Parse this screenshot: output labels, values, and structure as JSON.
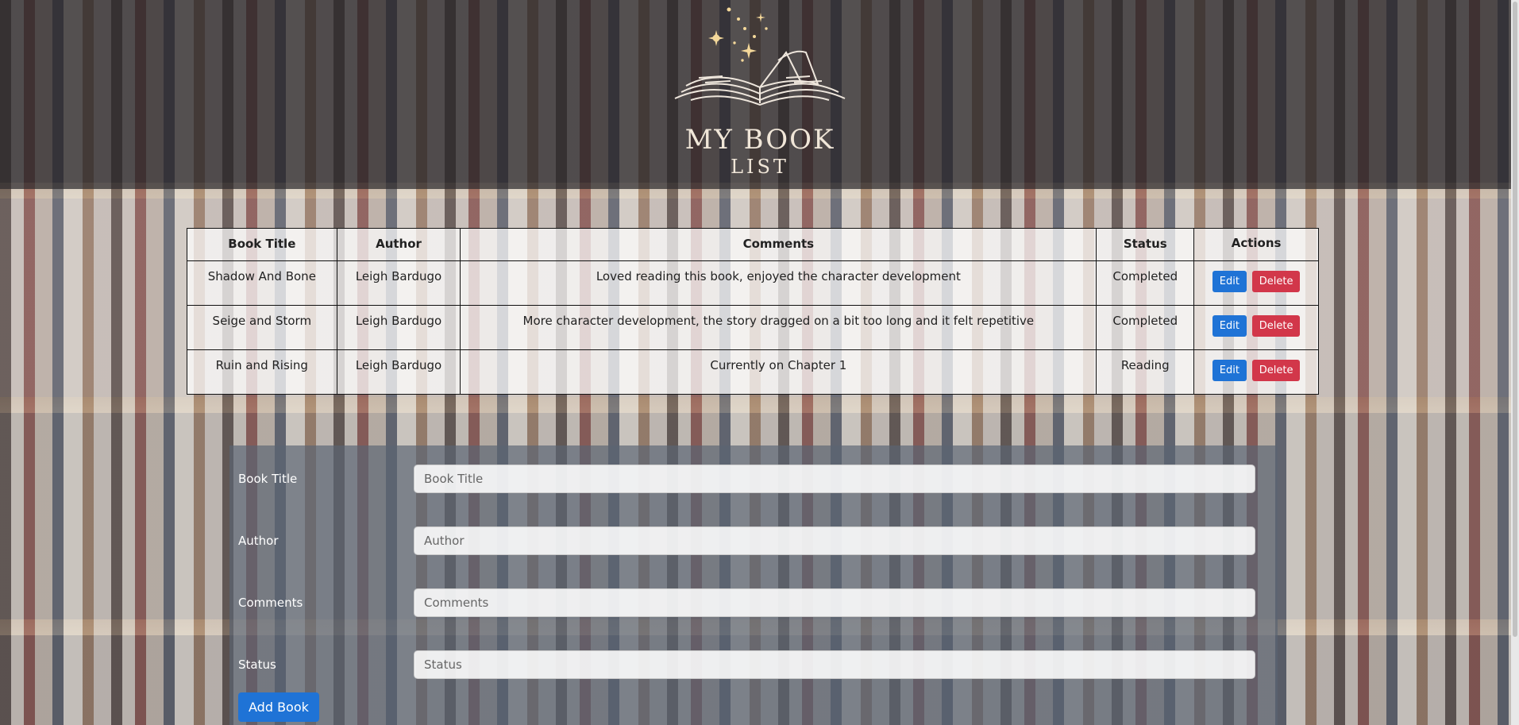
{
  "logo": {
    "line1": "MY BOOK",
    "line2": "LIST"
  },
  "table": {
    "headers": [
      "Book Title",
      "Author",
      "Comments",
      "Status",
      "Actions"
    ],
    "rows": [
      {
        "title": "Shadow And Bone",
        "author": "Leigh Bardugo",
        "comments": "Loved reading this book, enjoyed the character development",
        "status": "Completed",
        "edit_label": "Edit",
        "delete_label": "Delete"
      },
      {
        "title": "Seige and Storm",
        "author": "Leigh Bardugo",
        "comments": "More character development, the story dragged on a bit too long and it felt repetitive",
        "status": "Completed",
        "edit_label": "Edit",
        "delete_label": "Delete"
      },
      {
        "title": "Ruin and Rising",
        "author": "Leigh Bardugo",
        "comments": "Currently on Chapter 1",
        "status": "Reading",
        "edit_label": "Edit",
        "delete_label": "Delete"
      }
    ]
  },
  "form": {
    "fields": [
      {
        "label": "Book Title",
        "placeholder": "Book Title",
        "value": ""
      },
      {
        "label": "Author",
        "placeholder": "Author",
        "value": ""
      },
      {
        "label": "Comments",
        "placeholder": "Comments",
        "value": ""
      },
      {
        "label": "Status",
        "placeholder": "Status",
        "value": ""
      }
    ],
    "submit_label": "Add Book"
  },
  "colors": {
    "primary": "#1f73d6",
    "danger": "#d2374a",
    "logo_text": "#f0e6d8"
  },
  "icons": [
    "open-book-icon",
    "sparkle-icon"
  ]
}
